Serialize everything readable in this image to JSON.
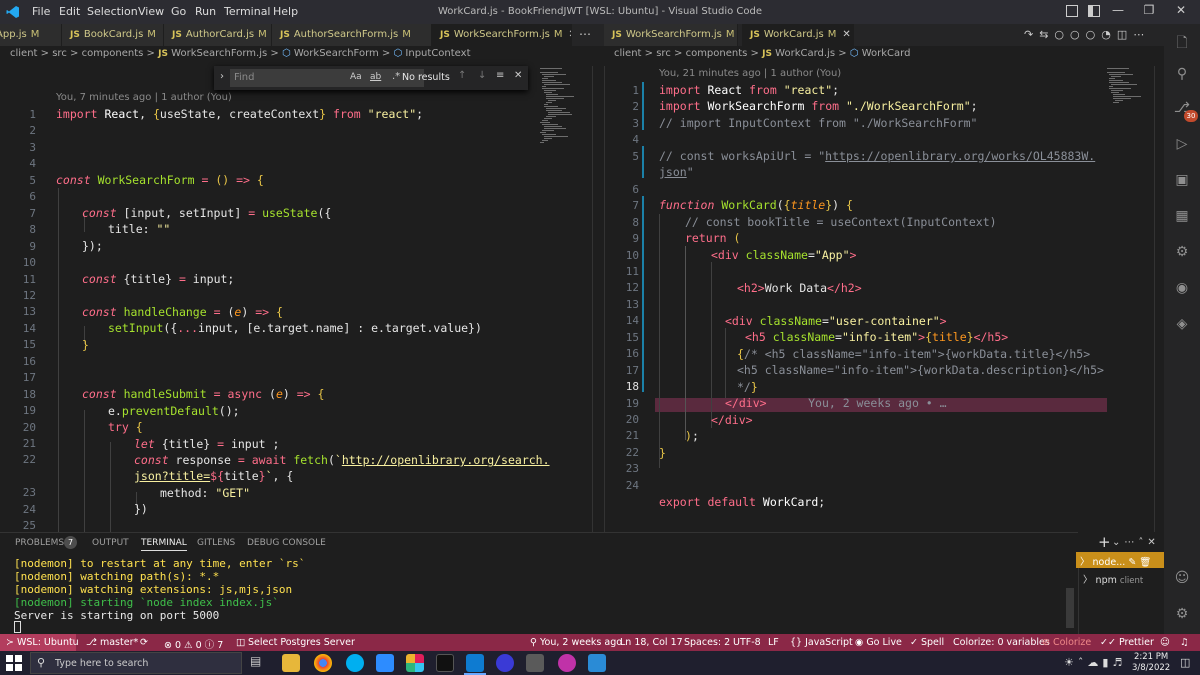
{
  "window": {
    "title": "WorkCard.js - BookFriendJWT [WSL: Ubuntu] - Visual Studio Code",
    "menu": [
      "File",
      "Edit",
      "Selection",
      "View",
      "Go",
      "Run",
      "Terminal",
      "Help"
    ]
  },
  "left_tabs": [
    {
      "name": "App.js",
      "mod": "M"
    },
    {
      "name": "BookCard.js",
      "mod": "M"
    },
    {
      "name": "AuthorCard.js",
      "mod": "M"
    },
    {
      "name": "AuthorSearchForm.js",
      "mod": "M"
    },
    {
      "name": "WorkSearchForm.js",
      "mod": "M",
      "active": true
    }
  ],
  "right_tabs": [
    {
      "name": "WorkSearchForm.js",
      "mod": "M"
    },
    {
      "name": "WorkCard.js",
      "mod": "M",
      "active": true
    }
  ],
  "left_breadcrumb": {
    "p1": "client",
    "p2": "src",
    "p3": "components",
    "file": "WorkSearchForm.js",
    "sym1": "WorkSearchForm",
    "sym2": "InputContext"
  },
  "right_breadcrumb": {
    "p1": "client",
    "p2": "src",
    "p3": "components",
    "file": "WorkCard.js",
    "sym1": "WorkCard"
  },
  "find": {
    "placeholder": "Find",
    "result": "No results",
    "case": "Aa",
    "word": "ab",
    "regex": ".*"
  },
  "left_blame": "You, 7 minutes ago | 1 author (You)",
  "right_blame": "You, 21 minutes ago | 1 author (You)",
  "left_line_numbers": [
    "1",
    "2",
    "3",
    "4",
    "5",
    "6",
    "7",
    "8",
    "9",
    "10",
    "11",
    "12",
    "13",
    "14",
    "15",
    "16",
    "17",
    "18",
    "19",
    "20",
    "21",
    "22",
    "",
    "23",
    "24",
    "25"
  ],
  "right_line_numbers": [
    "1",
    "2",
    "3",
    "4",
    "5",
    "",
    "6",
    "7",
    "8",
    "9",
    "10",
    "11",
    "12",
    "13",
    "14",
    "15",
    "16",
    "17",
    "18",
    "19",
    "20",
    "21",
    "22",
    "23",
    "24"
  ],
  "inline_blame": "You, 2 weeks ago • …",
  "panel": {
    "tabs": [
      "PROBLEMS",
      "OUTPUT",
      "TERMINAL",
      "GITLENS",
      "DEBUG CONSOLE"
    ],
    "problems_count": "7",
    "terminal_lines": [
      "[nodemon] to restart at any time, enter `rs`",
      "[nodemon] watching path(s): *.*",
      "[nodemon] watching extensions: js,mjs,json",
      "[nodemon] starting `node index index.js`",
      "Server is starting on port 5000"
    ],
    "terminals": [
      "node...",
      "npm"
    ],
    "npm_sub": "client",
    "plus": "+"
  },
  "status": {
    "remote": "WSL: Ubuntu",
    "branch": "master*",
    "errors": "0",
    "warnings": "0",
    "info": "7",
    "db": "Select Postgres Server",
    "blame": "You, 2 weeks ago",
    "position": "Ln 18, Col 17",
    "spaces": "Spaces: 2",
    "encoding": "UTF-8",
    "eol": "LF",
    "lang": "JavaScript",
    "golive": "Go Live",
    "spell": "Spell",
    "colorize": "Colorize: 0 variables",
    "colorize2": "Colorize",
    "prettier": "Prettier"
  },
  "taskbar": {
    "search": "Type here to search",
    "time": "2:21 PM",
    "date": "3/8/2022"
  },
  "colors": {
    "statusbar": "#8b2847",
    "keyword": "#ff6e8a",
    "string": "#f8f0a0",
    "function": "#a6e22e"
  }
}
